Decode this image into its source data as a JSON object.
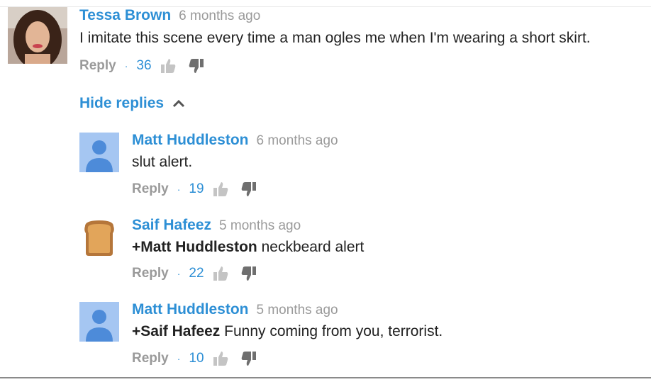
{
  "thread": {
    "top_comment": {
      "author": "Tessa Brown",
      "time": "6 months ago",
      "text": "I imitate this scene every time a man ogles me when I'm wearing a short skirt.",
      "reply_label": "Reply",
      "separator": "·",
      "likes": "36"
    },
    "hide_replies_label": "Hide replies",
    "replies": [
      {
        "author": "Matt Huddleston",
        "time": "6 months ago",
        "mention": "",
        "text": "slut alert.",
        "reply_label": "Reply",
        "separator": "·",
        "likes": "19"
      },
      {
        "author": "Saif Hafeez",
        "time": "5 months ago",
        "mention": "+Matt Huddleston",
        "text": " neckbeard alert",
        "reply_label": "Reply",
        "separator": "·",
        "likes": "22"
      },
      {
        "author": "Matt Huddleston",
        "time": "5 months ago",
        "mention": "+Saif Hafeez",
        "text": " Funny coming from you, terrorist.",
        "reply_label": "Reply",
        "separator": "·",
        "likes": "10"
      }
    ]
  },
  "icons": {
    "like": "thumbs-up-icon",
    "dislike": "thumbs-down-icon",
    "chevron": "chevron-up-icon"
  },
  "colors": {
    "link": "#2d8fd5",
    "muted": "#9a9a9a",
    "text": "#222222",
    "icon": "#c4c4c4",
    "avatar_placeholder": "#4d8bd9"
  }
}
